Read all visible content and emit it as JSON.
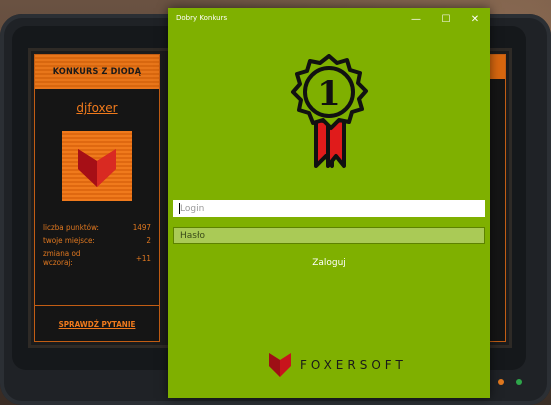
{
  "window": {
    "title": "Dobry Konkurs",
    "minimize_glyph": "—",
    "maximize_glyph": "☐",
    "close_glyph": "✕"
  },
  "badge": {
    "number": "1",
    "colors": {
      "rosette": "#7fb000",
      "outline": "#111111",
      "ribbon": "#e01b1b"
    }
  },
  "form": {
    "login_placeholder": "Login",
    "password_placeholder": "Hasło",
    "submit_label": "Zaloguj"
  },
  "brand": {
    "name": "FOXERSOFT",
    "logo_icon": "fox-logo-icon"
  },
  "background_app": {
    "header": "KONKURS Z DIODĄ",
    "username": "djfoxer",
    "avatar_icon": "fox-logo-icon",
    "stats": [
      {
        "label": "liczba punktów:",
        "value": "1497"
      },
      {
        "label": "twoje miejsce:",
        "value": "2"
      },
      {
        "label": "zmiana od wczoraj:",
        "value": "+11"
      }
    ],
    "link": "SPRAWDŹ PYTANIE"
  },
  "colors": {
    "window_bg": "#7fb000",
    "accent_orange": "#f07a1c",
    "led_orange": "#e0781f",
    "led_green": "#2ea64a"
  }
}
